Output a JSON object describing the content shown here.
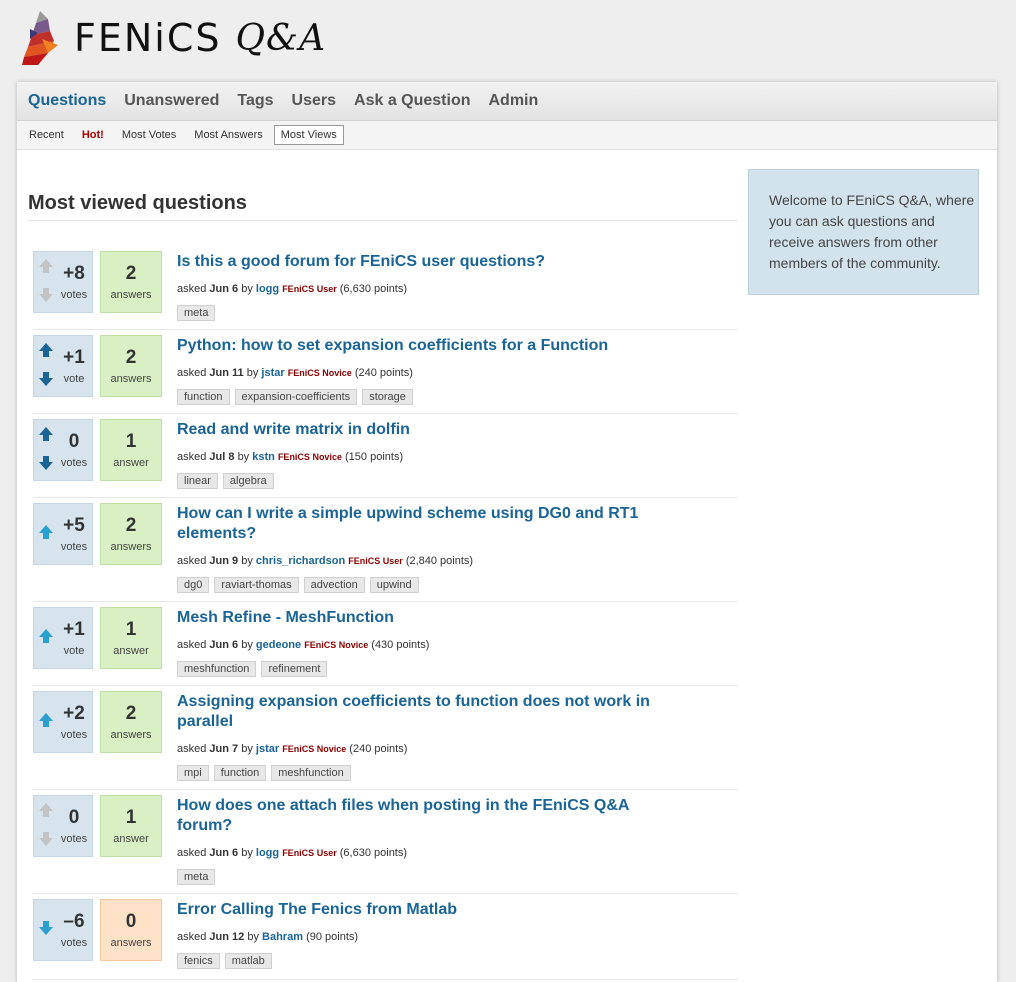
{
  "site": {
    "logo_text": "FENiCS",
    "logo_qa": "Q&A"
  },
  "nav": {
    "main": [
      "Questions",
      "Unanswered",
      "Tags",
      "Users",
      "Ask a Question",
      "Admin"
    ],
    "sub": [
      "Recent",
      "Hot!",
      "Most Votes",
      "Most Answers",
      "Most Views"
    ]
  },
  "page_title": "Most viewed questions",
  "sidebar": {
    "welcome": "Welcome to FEniCS Q&A, where you can ask questions and receive answers from other members of the community."
  },
  "colors": {
    "accent": "#1a6496",
    "vote_bg": "#d7e4ee",
    "answers_bg": "#d8f0c3",
    "no_answers_bg": "#fde2c8",
    "hot": "#b00000"
  },
  "questions": [
    {
      "votes": "+8",
      "vote_label": "votes",
      "vote_state": "none",
      "answers": "2",
      "answer_label": "answers",
      "title": "Is this a good forum for FEniCS user questions?",
      "asked": "asked",
      "when": "Jun 6",
      "by": "by",
      "user": "logg",
      "level": "FEniCS User",
      "points": "(6,630 points)",
      "tags": [
        "meta"
      ]
    },
    {
      "votes": "+1",
      "vote_label": "vote",
      "vote_state": "both",
      "answers": "2",
      "answer_label": "answers",
      "title": "Python: how to set expansion coefficients for a Function",
      "asked": "asked",
      "when": "Jun 11",
      "by": "by",
      "user": "jstar",
      "level": "FEniCS Novice",
      "points": "(240 points)",
      "tags": [
        "function",
        "expansion-coefficients",
        "storage"
      ]
    },
    {
      "votes": "0",
      "vote_label": "votes",
      "vote_state": "both",
      "answers": "1",
      "answer_label": "answer",
      "title": "Read and write matrix in dolfin",
      "asked": "asked",
      "when": "Jul 8",
      "by": "by",
      "user": "kstn",
      "level": "FEniCS Novice",
      "points": "(150 points)",
      "tags": [
        "linear",
        "algebra"
      ]
    },
    {
      "votes": "+5",
      "vote_label": "votes",
      "vote_state": "up",
      "answers": "2",
      "answer_label": "answers",
      "title": "How can I write a simple upwind scheme using DG0 and RT1 elements?",
      "asked": "asked",
      "when": "Jun 9",
      "by": "by",
      "user": "chris_richardson",
      "level": "FEniCS User",
      "points": "(2,840 points)",
      "tags": [
        "dg0",
        "raviart-thomas",
        "advection",
        "upwind"
      ]
    },
    {
      "votes": "+1",
      "vote_label": "vote",
      "vote_state": "up",
      "answers": "1",
      "answer_label": "answer",
      "title": "Mesh Refine - MeshFunction",
      "asked": "asked",
      "when": "Jun 6",
      "by": "by",
      "user": "gedeone",
      "level": "FEniCS Novice",
      "points": "(430 points)",
      "tags": [
        "meshfunction",
        "refinement"
      ]
    },
    {
      "votes": "+2",
      "vote_label": "votes",
      "vote_state": "up",
      "answers": "2",
      "answer_label": "answers",
      "title": "Assigning expansion coefficients to function does not work in parallel",
      "asked": "asked",
      "when": "Jun 7",
      "by": "by",
      "user": "jstar",
      "level": "FEniCS Novice",
      "points": "(240 points)",
      "tags": [
        "mpi",
        "function",
        "meshfunction"
      ]
    },
    {
      "votes": "0",
      "vote_label": "votes",
      "vote_state": "none",
      "answers": "1",
      "answer_label": "answer",
      "title": "How does one attach files when posting in the FEniCS Q&A forum?",
      "asked": "asked",
      "when": "Jun 6",
      "by": "by",
      "user": "logg",
      "level": "FEniCS User",
      "points": "(6,630 points)",
      "tags": [
        "meta"
      ]
    },
    {
      "votes": "–6",
      "vote_label": "votes",
      "vote_state": "down",
      "answers": "0",
      "answer_label": "answers",
      "title": "Error Calling The Fenics from Matlab",
      "asked": "asked",
      "when": "Jun 12",
      "by": "by",
      "user": "Bahram",
      "level": "",
      "points": "(90 points)",
      "tags": [
        "fenics",
        "matlab"
      ]
    }
  ]
}
